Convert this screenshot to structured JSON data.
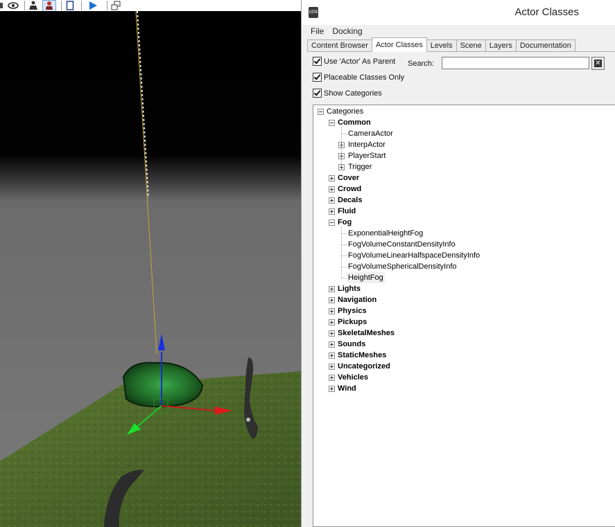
{
  "window": {
    "title": "Actor Classes",
    "app_icon_label": "UDK"
  },
  "menu": [
    {
      "label": "File"
    },
    {
      "label": "Docking"
    }
  ],
  "tabs": [
    {
      "label": "Content Browser",
      "active": false
    },
    {
      "label": "Actor Classes",
      "active": true
    },
    {
      "label": "Levels",
      "active": false
    },
    {
      "label": "Scene",
      "active": false
    },
    {
      "label": "Layers",
      "active": false
    },
    {
      "label": "Documentation",
      "active": false
    }
  ],
  "options": {
    "use_actor_parent": {
      "label": "Use 'Actor' As Parent",
      "checked": true
    },
    "placeable_only": {
      "label": "Placeable Classes Only",
      "checked": true
    },
    "show_categories": {
      "label": "Show Categories",
      "checked": true
    }
  },
  "search": {
    "label": "Search:",
    "value": "",
    "placeholder": ""
  },
  "tree": {
    "root": "Categories",
    "categories": [
      {
        "label": "Common",
        "expanded": true,
        "children": [
          {
            "label": "CameraActor",
            "expandable": false
          },
          {
            "label": "InterpActor",
            "expandable": true
          },
          {
            "label": "PlayerStart",
            "expandable": true
          },
          {
            "label": "Trigger",
            "expandable": true
          }
        ]
      },
      {
        "label": "Cover",
        "expanded": false
      },
      {
        "label": "Crowd",
        "expanded": false
      },
      {
        "label": "Decals",
        "expanded": false
      },
      {
        "label": "Fluid",
        "expanded": false
      },
      {
        "label": "Fog",
        "expanded": true,
        "children": [
          {
            "label": "ExponentialHeightFog",
            "expandable": false
          },
          {
            "label": "FogVolumeConstantDensityInfo",
            "expandable": false
          },
          {
            "label": "FogVolumeLinearHalfspaceDensityInfo",
            "expandable": false
          },
          {
            "label": "FogVolumeSphericalDensityInfo",
            "expandable": false
          },
          {
            "label": "HeightFog",
            "expandable": false,
            "selected": true
          }
        ]
      },
      {
        "label": "Lights",
        "expanded": false
      },
      {
        "label": "Navigation",
        "expanded": false
      },
      {
        "label": "Physics",
        "expanded": false
      },
      {
        "label": "Pickups",
        "expanded": false
      },
      {
        "label": "SkeletalMeshes",
        "expanded": false
      },
      {
        "label": "Sounds",
        "expanded": false
      },
      {
        "label": "StaticMeshes",
        "expanded": false
      },
      {
        "label": "Uncategorized",
        "expanded": false
      },
      {
        "label": "Vehicles",
        "expanded": false
      },
      {
        "label": "Wind",
        "expanded": false
      }
    ]
  },
  "viewport_toolbar": [
    {
      "icon": "unlit-icon"
    },
    {
      "icon": "eye-icon"
    },
    {
      "icon": "actor-icon"
    },
    {
      "icon": "character-icon"
    },
    {
      "icon": "page-icon"
    },
    {
      "icon": "play-icon"
    },
    {
      "icon": "float-window-icon"
    }
  ],
  "colors": {
    "accent": "#1a6fd0",
    "grass": "#4d6a2a",
    "fog": "#787878"
  }
}
